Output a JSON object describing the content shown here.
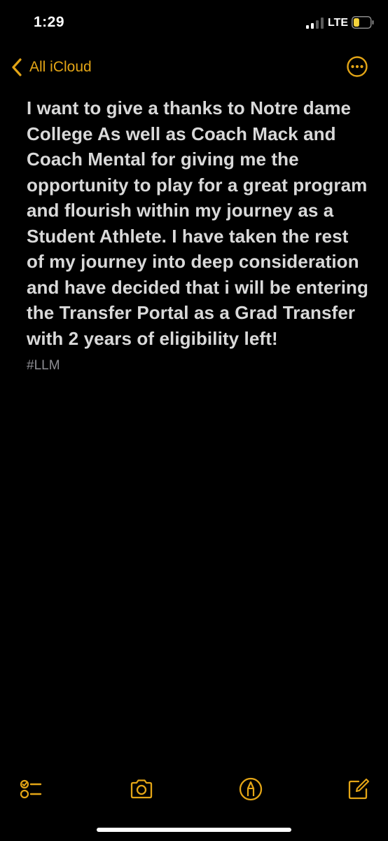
{
  "status_bar": {
    "time": "1:29",
    "carrier": "LTE",
    "signal_bars": 4,
    "signal_bars_active": 2,
    "battery_level": 0.35,
    "battery_color": "#f5d33b"
  },
  "nav": {
    "back_label": "All iCloud",
    "accent_color": "#e3a516",
    "back_icon": "chevron-left-icon",
    "more_icon": "ellipsis-circle-icon"
  },
  "note": {
    "body": "I want to give a thanks to Notre dame College As well as Coach Mack and Coach Mental for giving me the opportunity to play for a great program and flourish within my journey as a Student Athlete. I have taken the rest of my journey into deep consideration and have decided that i will be entering the Transfer Portal as a Grad Transfer with 2 years of eligibility left!",
    "tag": "#LLM"
  },
  "toolbar": {
    "icons": [
      "checklist-icon",
      "camera-icon",
      "markup-icon",
      "compose-icon"
    ]
  }
}
